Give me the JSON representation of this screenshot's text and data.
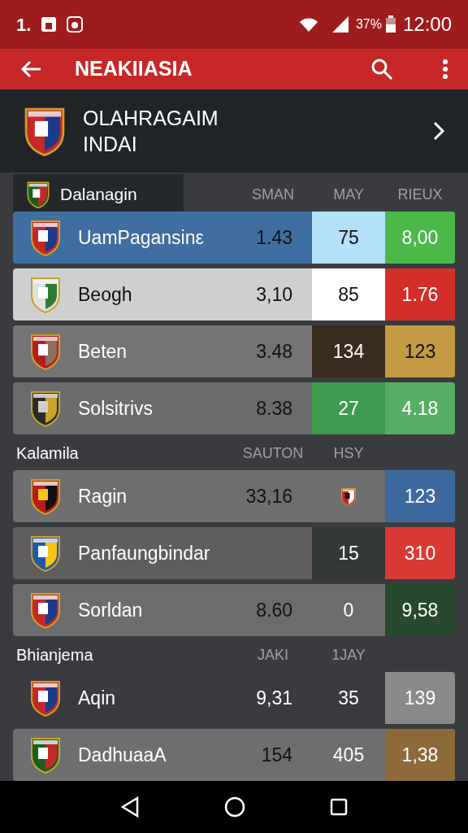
{
  "status_bar": {
    "left_text": "1.",
    "battery": "37%",
    "time": "12:00"
  },
  "toolbar": {
    "title": "NEAKIIASIA"
  },
  "header": {
    "title_lines": [
      "OLAHRAGAIM",
      "INDAI"
    ]
  },
  "sections": [
    {
      "title": "Dalanagin",
      "kind": "tab",
      "columns": [
        "",
        "SMAN",
        "MAY",
        "RIEUX"
      ],
      "rows": [
        {
          "team": "UamPagansinε",
          "value": "1.43",
          "color": "#3f6fa0",
          "cells": [
            {
              "kind": "text",
              "text": "75",
              "color": "#b3e0fa"
            },
            {
              "kind": "text",
              "text": "8,00",
              "color": "#4cb84a"
            }
          ]
        },
        {
          "team": "Beogh",
          "value": "3,10",
          "color": "#cfcfcf",
          "cells": [
            {
              "kind": "text",
              "text": "85",
              "color": "#ffffff"
            },
            {
              "kind": "text",
              "text": "1.76",
              "color": "#d42e2a"
            }
          ]
        },
        {
          "team": "Beten",
          "value": "3.48",
          "color": "#747474",
          "cells": [
            {
              "kind": "text",
              "text": "134",
              "color": "#3a2c1e"
            },
            {
              "kind": "text",
              "text": "123",
              "color": "#c49a45"
            }
          ]
        },
        {
          "team": "Solsitrivs",
          "value": "8.38",
          "color": "#6b6b6b",
          "cells": [
            {
              "kind": "text",
              "text": "27",
              "color": "#3f9a4e"
            },
            {
              "kind": "text",
              "text": "4.18",
              "color": "#55ae62"
            }
          ]
        }
      ]
    },
    {
      "title": "Kalamila",
      "kind": "plain",
      "columns": [
        "",
        "SAUTON",
        "HSY"
      ],
      "rows": [
        {
          "team": "Ragin",
          "value": "33,16",
          "color": "#6e6e6e",
          "cells": [
            {
              "kind": "icon",
              "color": "#6e6e6e"
            },
            {
              "kind": "text",
              "text": "123",
              "color": "#3d6a9e"
            }
          ]
        },
        {
          "team": "Panfaungbindar",
          "color": "#5f5d5d",
          "cells": [
            {
              "kind": "text",
              "text": "15",
              "color": "#353839"
            },
            {
              "kind": "text",
              "text": "310",
              "color": "#d83b35"
            }
          ]
        },
        {
          "team": "Sorldan",
          "value": "8.60",
          "color": "#6c6c6c",
          "cells": [
            {
              "kind": "text",
              "text": "0",
              "color": "#6c6c6c"
            },
            {
              "kind": "text",
              "text": "9,58",
              "color": "#274a2e"
            }
          ]
        }
      ]
    },
    {
      "title": "Bhianjema",
      "kind": "plain",
      "columns": [
        "",
        "JAKI",
        "1JAY"
      ],
      "rows": [
        {
          "team": "Aqin",
          "value": "9,31",
          "color": "#3a3b3e",
          "cells": [
            {
              "kind": "text",
              "text": "35",
              "color": "#3a3b3e"
            },
            {
              "kind": "text",
              "text": "139",
              "color": "#8a8a8a"
            }
          ]
        },
        {
          "team": "DadhuaaA",
          "value": "154",
          "color": "#6e6e6e",
          "cells": [
            {
              "kind": "text",
              "text": "405",
              "color": "#6e6e6e"
            },
            {
              "kind": "text",
              "text": "1,38",
              "color": "#8e6a3a"
            }
          ]
        }
      ]
    }
  ]
}
